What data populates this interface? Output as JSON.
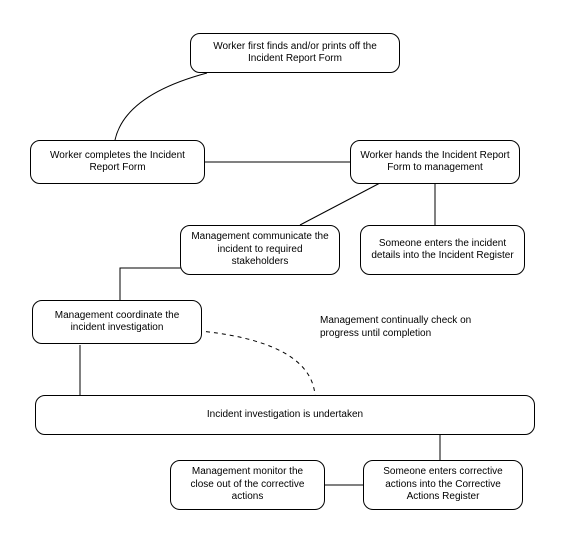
{
  "nodes": {
    "n1": "Worker first finds and/or prints off the Incident Report Form",
    "n2": "Worker completes the Incident Report Form",
    "n3": "Worker hands the Incident Report Form to management",
    "n4": "Management communicate the incident to required stakeholders",
    "n5": "Someone enters the incident details into the Incident Register",
    "n6": "Management coordinate the incident investigation",
    "n7": "Incident investigation is undertaken",
    "n8": "Management monitor the close out of the corrective actions",
    "n9": "Someone enters corrective actions into the Corrective Actions Register"
  },
  "annotation": "Management continually check on progress until completion",
  "chart_data": {
    "type": "flowchart",
    "title": "",
    "nodes": [
      {
        "id": "n1",
        "label": "Worker first finds and/or prints off the Incident Report Form"
      },
      {
        "id": "n2",
        "label": "Worker completes the Incident Report Form"
      },
      {
        "id": "n3",
        "label": "Worker hands the Incident Report Form to management"
      },
      {
        "id": "n4",
        "label": "Management communicate the incident to required stakeholders"
      },
      {
        "id": "n5",
        "label": "Someone enters the incident details into the Incident Register"
      },
      {
        "id": "n6",
        "label": "Management coordinate the incident investigation"
      },
      {
        "id": "n7",
        "label": "Incident investigation is undertaken"
      },
      {
        "id": "n8",
        "label": "Management monitor the close out of the corrective actions"
      },
      {
        "id": "n9",
        "label": "Someone enters corrective actions into the Corrective Actions Register"
      }
    ],
    "edges": [
      {
        "from": "n1",
        "to": "n2",
        "style": "curved"
      },
      {
        "from": "n2",
        "to": "n3",
        "style": "solid"
      },
      {
        "from": "n3",
        "to": "n5",
        "style": "solid"
      },
      {
        "from": "n3",
        "to": "n4",
        "style": "solid"
      },
      {
        "from": "n4",
        "to": "n6",
        "style": "solid"
      },
      {
        "from": "n6",
        "to": "n7",
        "style": "solid"
      },
      {
        "from": "n7",
        "to": "n9",
        "style": "solid"
      },
      {
        "from": "n9",
        "to": "n8",
        "style": "solid"
      },
      {
        "from": "n6",
        "to": "n7",
        "style": "dashed",
        "label": "Management continually check on progress until completion"
      }
    ]
  }
}
